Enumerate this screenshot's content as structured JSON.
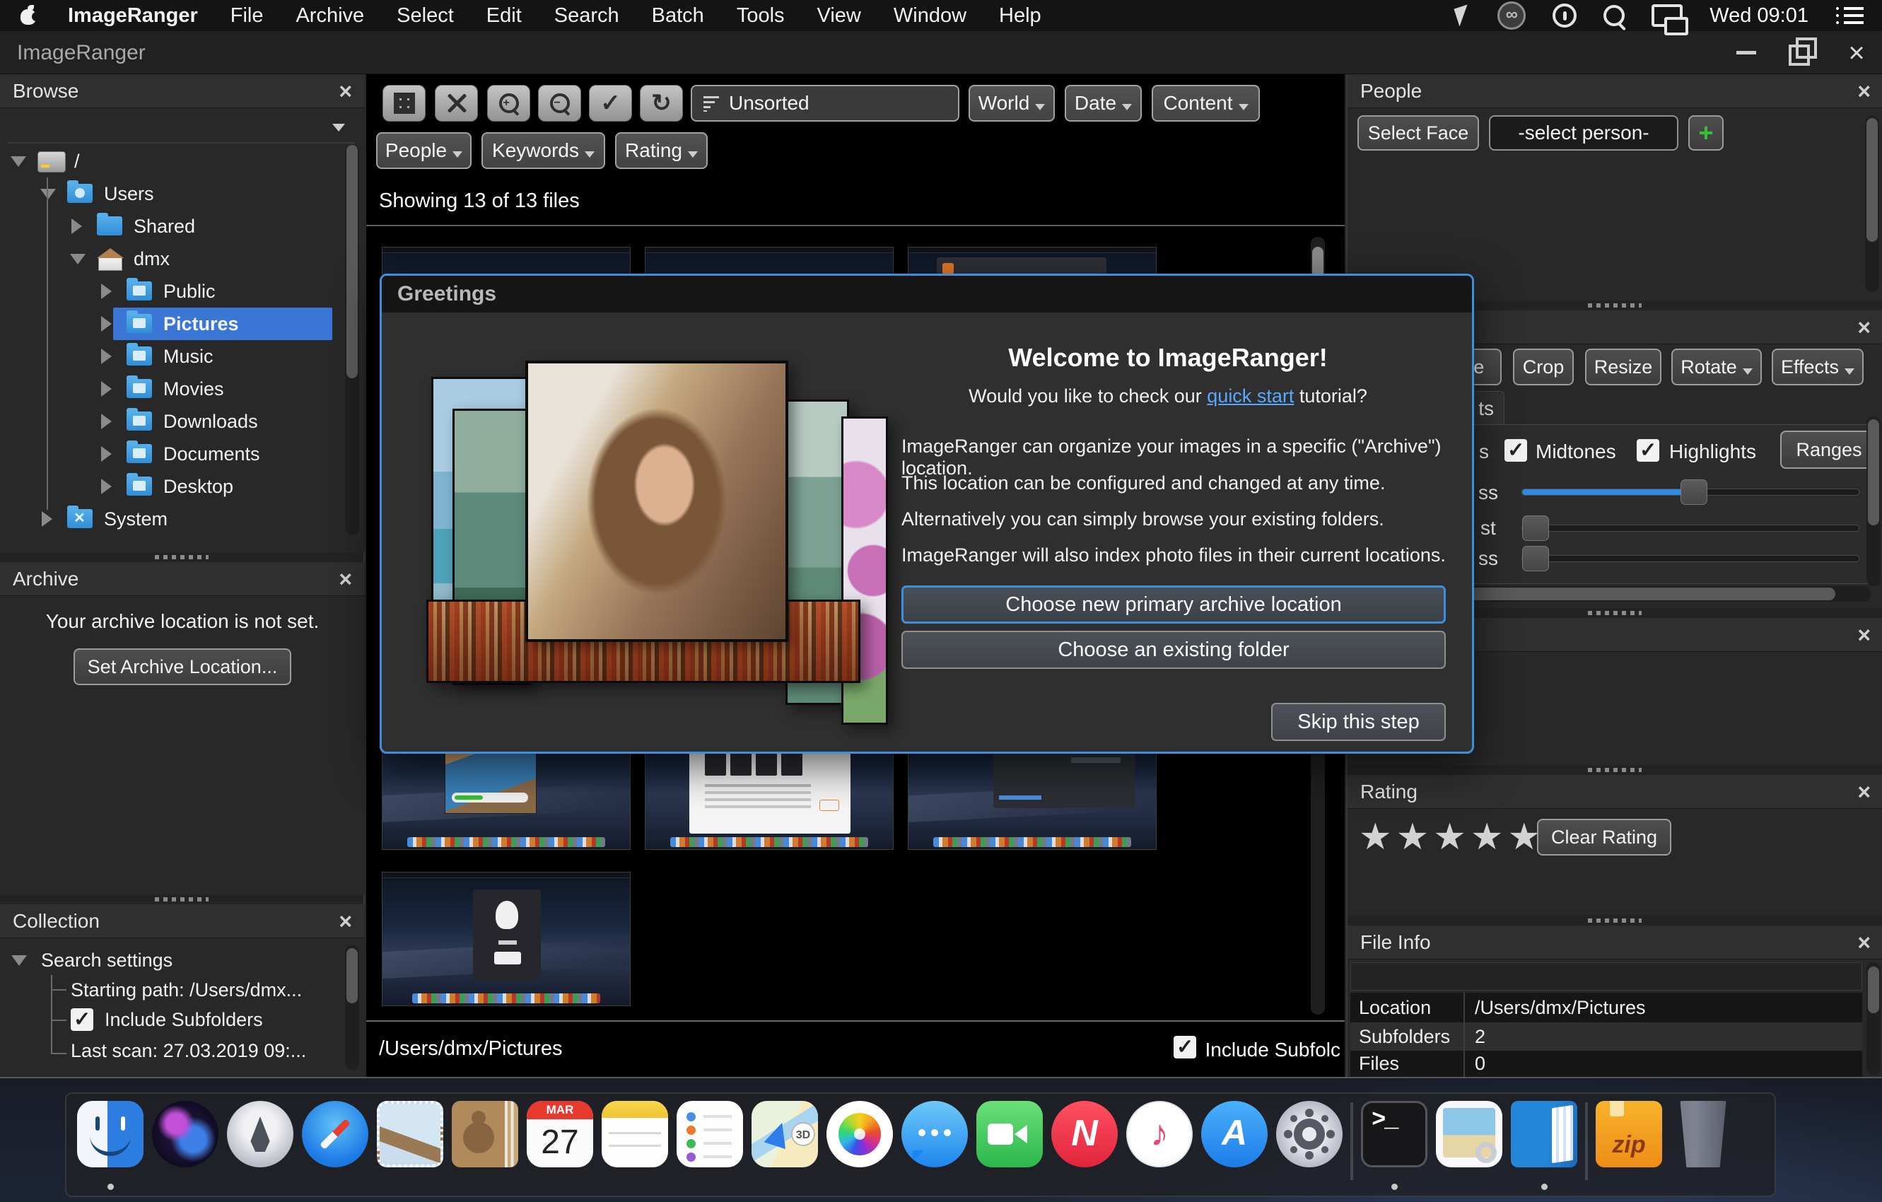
{
  "menubar": {
    "app_name": "ImageRanger",
    "menus": [
      "File",
      "Archive",
      "Select",
      "Edit",
      "Search",
      "Batch",
      "Tools",
      "View",
      "Window",
      "Help"
    ],
    "clock": "Wed 09:01"
  },
  "window": {
    "title": "ImageRanger"
  },
  "sidebar": {
    "browse": {
      "title": "Browse",
      "items": [
        "/",
        "Users",
        "Shared",
        "dmx",
        "Public",
        "Pictures",
        "Music",
        "Movies",
        "Downloads",
        "Documents",
        "Desktop",
        "System"
      ]
    },
    "archive": {
      "title": "Archive",
      "message": "Your archive location is not set.",
      "set_button": "Set Archive Location..."
    },
    "collection": {
      "title": "Collection",
      "root": "Search settings",
      "starting_path": "Starting path: /Users/dmx...",
      "include_subfolders": "Include Subfolders",
      "last_scan": "Last scan: 27.03.2019 09:..."
    }
  },
  "toolbar": {
    "sort_value": "Unsorted",
    "filters": {
      "world": "World",
      "date": "Date",
      "content": "Content",
      "people": "People",
      "keywords": "Keywords",
      "rating": "Rating"
    }
  },
  "content": {
    "showing": "Showing 13 of 13 files",
    "path": "/Users/dmx/Pictures",
    "include_subfolders": "Include Subfolc"
  },
  "dialog": {
    "title": "Greetings",
    "heading": "Welcome to ImageRanger!",
    "question_pre": "Would you like to check our ",
    "question_link": "quick start",
    "question_post": " tutorial?",
    "para1": "ImageRanger can organize your images in a specific (\"Archive\") location.",
    "para2": "This location can be configured and changed at any time.",
    "para3": "Alternatively you can simply browse your existing folders.",
    "para4": "ImageRanger will also index photo files in their current locations.",
    "primary_button": "Choose new primary archive location",
    "secondary_button": "Choose an existing folder",
    "skip_button": "Skip this step"
  },
  "people_panel": {
    "title": "People",
    "select_face": "Select Face",
    "person_dropdown": "-select person-",
    "add_button": "+"
  },
  "edit_panel": {
    "button_partial": "ce",
    "crop": "Crop",
    "resize": "Resize",
    "rotate": "Rotate",
    "effects": "Effects",
    "tab_partial": "ts",
    "checkbox_partial": "s",
    "midtones": "Midtones",
    "highlights": "Highlights",
    "ranges": "Ranges",
    "slider1_label_partial": "ss",
    "slider2_label_partial": "st",
    "slider3_label_partial": "ss"
  },
  "rating_panel": {
    "title": "Rating",
    "star_char": "★",
    "clear_button": "Clear Rating"
  },
  "file_info": {
    "title": "File Info",
    "rows": [
      {
        "label": "Location",
        "value": "/Users/dmx/Pictures"
      },
      {
        "label": "Subfolders",
        "value": "2"
      },
      {
        "label": "Files",
        "value": "0"
      }
    ]
  },
  "dock": {
    "calendar_month": "MAR",
    "calendar_day": "27",
    "maps_badge": "3D",
    "news_letter": "N",
    "itunes_note": "♪",
    "appstore_letter": "A",
    "terminal_glyph": ">_",
    "zip_label": "zip",
    "apps": [
      "finder",
      "siri",
      "launchpad",
      "safari",
      "mail",
      "contacts",
      "calendar",
      "notes",
      "reminders",
      "maps",
      "photos",
      "messages",
      "facetime",
      "news",
      "itunes",
      "app-store",
      "system-preferences",
      "terminal",
      "preview",
      "imageranger",
      "zip-archive",
      "trash"
    ]
  },
  "colors": {
    "selection_blue": "#3a76d6",
    "dialog_border": "#3f8edc",
    "link_blue": "#5aa7ff",
    "slider_fill": "#2f8be0",
    "plus_green": "#35c035"
  }
}
